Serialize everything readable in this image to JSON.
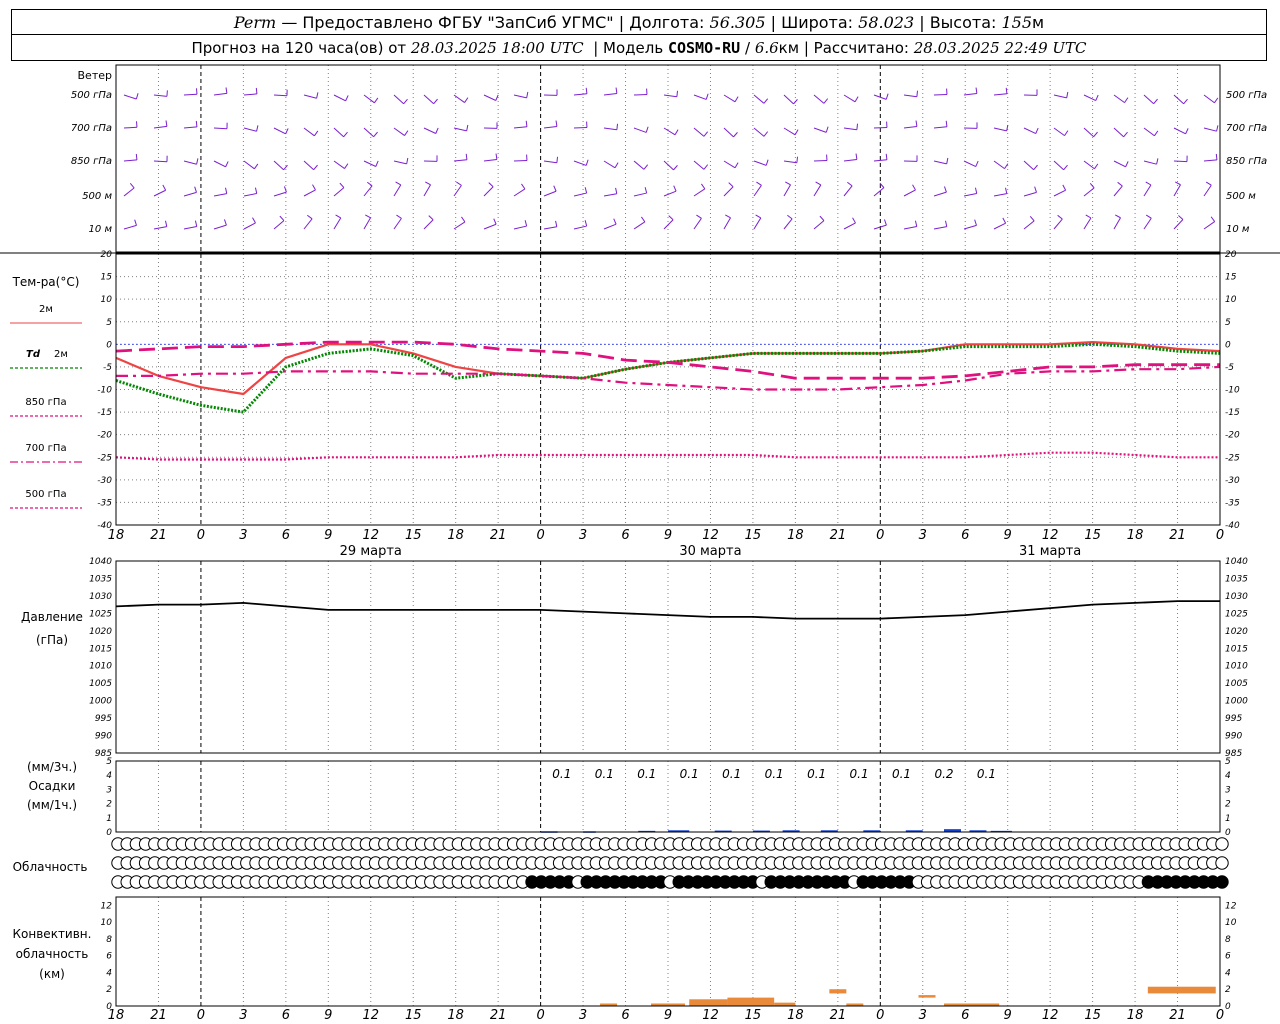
{
  "header": {
    "station": "Perm",
    "provider": "— Предоставлено ФГБУ \"ЗапСиб УГМС\"",
    "lon_label": "Долгота:",
    "lon_value": "56.305",
    "lat_label": "Широта:",
    "lat_value": "58.023",
    "alt_label": "Высота:",
    "alt_value": "155",
    "alt_unit": "м",
    "forecast_label": "Прогноз на 120 часа(ов) от",
    "forecast_start": "28.03.2025 18:00 UTC",
    "model_label": "Модель",
    "model_name": "COSMO-RU",
    "model_res": "6.6",
    "model_res_unit": "км",
    "computed_label": "Рассчитано:",
    "computed_time": "28.03.2025 22:49 UTC"
  },
  "colors": {
    "t2m": "#ee4444",
    "td2m": "#008800",
    "upper": "#e0107f",
    "wind": "#7b1fd0",
    "pressure": "#000000",
    "precip": "#1040d0",
    "convective": "#e88a3a",
    "grid": "#808080"
  },
  "chart_data": {
    "type": "line",
    "time_axis": {
      "tick_labels": [
        "18",
        "21",
        "0",
        "3",
        "6",
        "9",
        "12",
        "15",
        "18",
        "21",
        "0",
        "3",
        "6",
        "9",
        "12",
        "15",
        "18",
        "21",
        "0",
        "3",
        "6",
        "9",
        "12",
        "15",
        "18",
        "21",
        "0"
      ],
      "day_labels": [
        {
          "label": "29 марта",
          "at_index": 6
        },
        {
          "label": "30 марта",
          "at_index": 14
        },
        {
          "label": "31 марта",
          "at_index": 22
        }
      ]
    },
    "wind": {
      "label": "Ветер",
      "levels": [
        "500 гПа",
        "700 гПа",
        "850 гПа",
        "500 м",
        "10 м"
      ]
    },
    "temperature": {
      "title_line1": "Тем-ра(°C)",
      "ylim": [
        -40,
        20
      ],
      "yticks": [
        20,
        15,
        10,
        5,
        0,
        -5,
        -10,
        -15,
        -20,
        -25,
        -30,
        -35,
        -40
      ],
      "series": [
        {
          "name": "2м",
          "key": "t2m",
          "style": "solid",
          "values": [
            -3,
            -7,
            -9.5,
            -11,
            -3,
            0,
            0,
            -2,
            -5,
            -6.5,
            -7,
            -7.5,
            -5.5,
            -4,
            -3,
            -2,
            -2,
            -2,
            -2,
            -1.5,
            0,
            0,
            0,
            0.5,
            0,
            -1,
            -1.5
          ]
        },
        {
          "name": "Td",
          "suffix": "2м",
          "key": "td2m",
          "style": "dotted-thick",
          "values": [
            -8,
            -11,
            -13.5,
            -15,
            -5,
            -2,
            -1,
            -2.5,
            -7.5,
            -6.5,
            -7,
            -7.5,
            -5.5,
            -4,
            -3,
            -2,
            -2,
            -2,
            -2,
            -1.5,
            -0.5,
            -0.5,
            -0.5,
            0,
            -0.5,
            -1.5,
            -2
          ]
        },
        {
          "name": "850 гПа",
          "key": "t850",
          "style": "longdash",
          "values": [
            -1.5,
            -1,
            -0.5,
            -0.5,
            0,
            0.5,
            0.5,
            0.5,
            0,
            -1,
            -1.5,
            -2,
            -3.5,
            -4,
            -5,
            -6,
            -7.5,
            -7.5,
            -7.5,
            -7.5,
            -7,
            -6,
            -5,
            -5,
            -4.5,
            -4.5,
            -4.5
          ]
        },
        {
          "name": "700 гПа",
          "key": "t700",
          "style": "dashdot",
          "values": [
            -7,
            -7,
            -6.5,
            -6.5,
            -6,
            -6,
            -6,
            -6.5,
            -6.5,
            -6.5,
            -7,
            -7.5,
            -8.5,
            -9,
            -9.5,
            -10,
            -10,
            -10,
            -9.5,
            -9,
            -8,
            -6.5,
            -6,
            -6,
            -5.5,
            -5.5,
            -5
          ]
        },
        {
          "name": "500 гПа",
          "key": "t500",
          "style": "dotted",
          "values": [
            -25,
            -25.5,
            -25.5,
            -25.5,
            -25.5,
            -25,
            -25,
            -25,
            -25,
            -24.5,
            -24.5,
            -24.5,
            -24.5,
            -24.5,
            -24.5,
            -24.5,
            -25,
            -25,
            -25,
            -25,
            -25,
            -24.5,
            -24,
            -24,
            -24.5,
            -25,
            -25
          ]
        }
      ]
    },
    "pressure": {
      "title_line1": "Давление",
      "title_line2": "(гПа)",
      "ylim": [
        985,
        1040
      ],
      "yticks": [
        1040,
        1035,
        1030,
        1025,
        1020,
        1015,
        1010,
        1005,
        1000,
        995,
        990,
        985
      ],
      "values": [
        1027,
        1027.5,
        1027.5,
        1028,
        1027,
        1026,
        1026,
        1026,
        1026,
        1026,
        1026,
        1025.5,
        1025,
        1024.5,
        1024,
        1024,
        1023.5,
        1023.5,
        1023.5,
        1024,
        1024.5,
        1025.5,
        1026.5,
        1027.5,
        1028,
        1028.5,
        1028.5
      ]
    },
    "precipitation": {
      "title_line1": "(мм/3ч.)",
      "title_line2": "Осадки",
      "title_line3": "(мм/1ч.)",
      "ylim": [
        0,
        5
      ],
      "yticks": [
        5,
        4,
        3,
        2,
        1,
        0
      ],
      "labels": [
        {
          "text": "0.1",
          "at_index": 10.5
        },
        {
          "text": "0.1",
          "at_index": 11.5
        },
        {
          "text": "0.1",
          "at_index": 12.5
        },
        {
          "text": "0.1",
          "at_index": 13.5
        },
        {
          "text": "0.1",
          "at_index": 14.5
        },
        {
          "text": "0.1",
          "at_index": 15.5
        },
        {
          "text": "0.1",
          "at_index": 16.5
        },
        {
          "text": "0.1",
          "at_index": 17.5
        },
        {
          "text": "0.1",
          "at_index": 18.5
        },
        {
          "text": "0.2",
          "at_index": 19.5
        },
        {
          "text": "0.1",
          "at_index": 20.5
        }
      ],
      "hourly_bars": [
        {
          "from_index": 10,
          "to_index": 10.4,
          "value": 0.05
        },
        {
          "from_index": 11,
          "to_index": 11.3,
          "value": 0.05
        },
        {
          "from_index": 12.3,
          "to_index": 12.7,
          "value": 0.08
        },
        {
          "from_index": 13,
          "to_index": 13.5,
          "value": 0.12
        },
        {
          "from_index": 14.1,
          "to_index": 14.5,
          "value": 0.1
        },
        {
          "from_index": 15,
          "to_index": 15.4,
          "value": 0.1
        },
        {
          "from_index": 15.7,
          "to_index": 16.1,
          "value": 0.12
        },
        {
          "from_index": 16.6,
          "to_index": 17,
          "value": 0.12
        },
        {
          "from_index": 17.6,
          "to_index": 18,
          "value": 0.12
        },
        {
          "from_index": 18.6,
          "to_index": 19,
          "value": 0.12
        },
        {
          "from_index": 19.5,
          "to_index": 19.9,
          "value": 0.2
        },
        {
          "from_index": 20.1,
          "to_index": 20.5,
          "value": 0.12
        },
        {
          "from_index": 20.6,
          "to_index": 21.1,
          "value": 0.08
        }
      ]
    },
    "cloudiness": {
      "title": "Облачность",
      "rows": [
        {
          "level": "high",
          "values": [
            0,
            0,
            0,
            0,
            0,
            0,
            0,
            0,
            0,
            0,
            0,
            0,
            0,
            0,
            0,
            0,
            0,
            0,
            0,
            0,
            0,
            0,
            0,
            0,
            0,
            0,
            0,
            0,
            0,
            0,
            0,
            0,
            0,
            0,
            0,
            0,
            0,
            0,
            0,
            0,
            0,
            0,
            0,
            0,
            0,
            0,
            0,
            0,
            0,
            0,
            0,
            0,
            0,
            0,
            0,
            0,
            0,
            0,
            0,
            0,
            0,
            0,
            0,
            0,
            0,
            0,
            0,
            0,
            0,
            0,
            0,
            0,
            0,
            0,
            0,
            0,
            0,
            0,
            0,
            0,
            0,
            0,
            0,
            0,
            0,
            0,
            0,
            0,
            0,
            0,
            0,
            0,
            0,
            0,
            0,
            0,
            0,
            0,
            0,
            0,
            0,
            0,
            0,
            0,
            0,
            0,
            0,
            0,
            0,
            0,
            0,
            0,
            0,
            0,
            0,
            0,
            0,
            0,
            0,
            0,
            0
          ]
        },
        {
          "level": "middle",
          "values": [
            0,
            0,
            0,
            0,
            0,
            0,
            0,
            0,
            0,
            0,
            0,
            0,
            0,
            0,
            0,
            0,
            0,
            0,
            0,
            0,
            0,
            0,
            0,
            0,
            0,
            0,
            0,
            0,
            0,
            0,
            0,
            0,
            0,
            0,
            0,
            0,
            0,
            0,
            0,
            0,
            0,
            0,
            0,
            0,
            0,
            0,
            0,
            0,
            0,
            0,
            0,
            0,
            0,
            0,
            0,
            0,
            0,
            0,
            0,
            0,
            0,
            0,
            0,
            0,
            0,
            0,
            0,
            0,
            0,
            0,
            0,
            0,
            0,
            0,
            0,
            0,
            0,
            0,
            0,
            0,
            0,
            0,
            0,
            0,
            0,
            0,
            0,
            0,
            0,
            0,
            0,
            0,
            0,
            0,
            0,
            0,
            0,
            0,
            0,
            0,
            0,
            0,
            0,
            0,
            0,
            0,
            0,
            0,
            0,
            0,
            0,
            0,
            0,
            0,
            0,
            0,
            0,
            0,
            0,
            0,
            0
          ]
        },
        {
          "level": "low",
          "values": [
            0,
            0,
            0,
            0,
            0,
            0,
            0,
            0,
            0,
            0,
            0,
            0,
            0,
            0,
            0,
            0,
            0,
            0,
            0,
            0,
            0,
            0,
            0,
            0,
            0,
            0,
            0,
            0,
            0,
            0,
            0,
            0,
            0,
            0,
            0,
            0,
            0,
            0,
            0,
            0,
            0,
            0,
            0,
            0,
            0,
            0,
            0,
            0,
            0,
            0,
            0,
            0,
            0,
            0,
            0,
            0,
            0,
            0,
            0,
            0,
            0,
            0,
            0,
            0,
            0,
            0,
            0,
            0,
            0,
            0,
            0,
            0,
            0,
            0,
            0,
            0,
            0,
            0,
            0,
            0,
            0,
            0,
            0,
            0,
            0,
            0,
            0,
            0,
            0,
            0,
            0,
            0,
            0,
            0,
            0,
            0,
            0,
            0,
            0,
            0,
            0,
            0,
            0,
            0,
            0,
            0,
            0,
            0,
            0,
            0,
            0,
            0,
            0,
            0,
            0,
            0,
            0,
            0,
            0,
            0,
            0
          ]
        }
      ]
    },
    "convective": {
      "title_line1": "Конвективн.",
      "title_line2": "облачность",
      "title_line3": "(км)",
      "ylim": [
        0,
        13
      ],
      "yticks": [
        12,
        10,
        8,
        6,
        4,
        2,
        0
      ],
      "bars": [
        {
          "from_index": 11.4,
          "to_index": 11.8,
          "top": 0.3
        },
        {
          "from_index": 12.6,
          "to_index": 13.4,
          "top": 0.3
        },
        {
          "from_index": 13.5,
          "to_index": 14.4,
          "top": 0.8
        },
        {
          "from_index": 14.4,
          "to_index": 15.5,
          "top": 1.0
        },
        {
          "from_index": 15.5,
          "to_index": 16,
          "top": 0.4
        },
        {
          "from_index": 16.8,
          "to_index": 17.2,
          "top": 2.0,
          "bottom": 1.5
        },
        {
          "from_index": 17.2,
          "to_index": 17.6,
          "top": 0.3
        },
        {
          "from_index": 18.9,
          "to_index": 19.3,
          "top": 1.3,
          "bottom": 1.0
        },
        {
          "from_index": 19.5,
          "to_index": 20.8,
          "top": 0.3
        },
        {
          "from_index": 24.3,
          "to_index": 25.9,
          "top": 2.3,
          "bottom": 1.5
        }
      ]
    }
  }
}
